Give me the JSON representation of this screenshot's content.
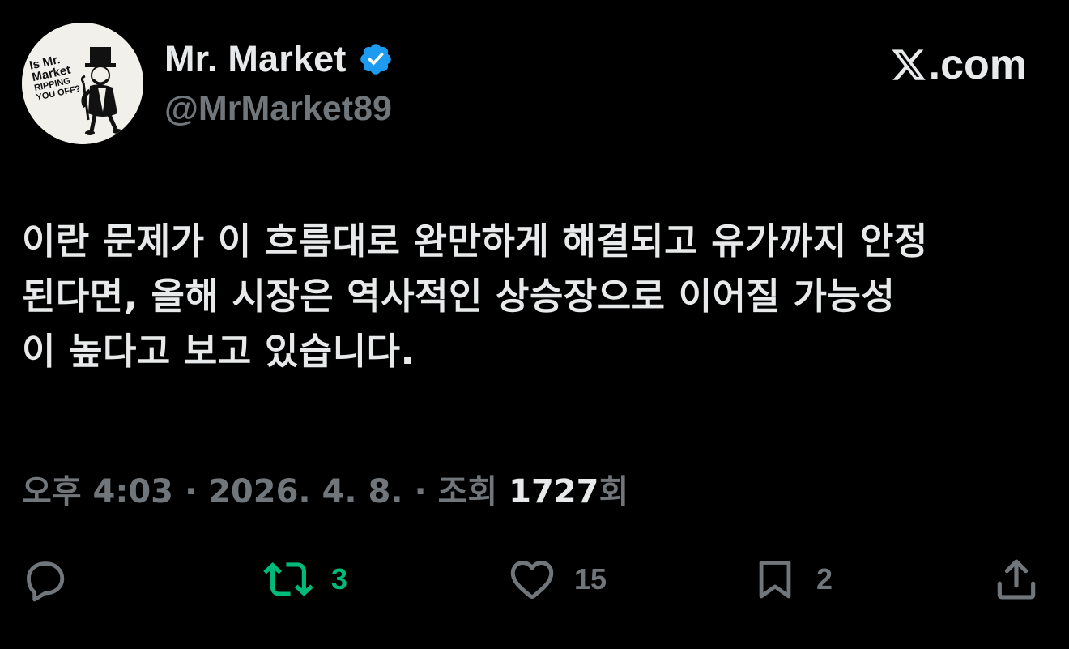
{
  "header": {
    "avatar": {
      "icon": "mr-market-monopoly-avatar",
      "caption_line1": "Is Mr.",
      "caption_line2": "Market",
      "caption_line3": "RIPPING",
      "caption_line4": "YOU OFF?"
    },
    "display_name": "Mr. Market",
    "verified_icon": "verified-badge-icon",
    "handle": "@MrMarket89",
    "brand": {
      "icon": "x-logo-icon",
      "text": ".com"
    }
  },
  "tweet": {
    "lines": [
      "이란 문제가 이 흐름대로 완만하게 해결되고 유가까지 안정",
      "된다면, 올해 시장은 역사적인 상승장으로 이어질 가능성",
      "이 높다고 보고 있습니다."
    ]
  },
  "meta": {
    "time": "오후 4:03",
    "separator": " · ",
    "date": "2026. 4. 8.",
    "views_label": "조회",
    "views_count": "1727",
    "views_suffix": "회"
  },
  "actions": {
    "reply": {
      "icon": "reply-icon",
      "count": ""
    },
    "retweet": {
      "icon": "retweet-icon",
      "count": "3"
    },
    "like": {
      "icon": "heart-icon",
      "count": "15"
    },
    "bookmark": {
      "icon": "bookmark-icon",
      "count": "2"
    },
    "share": {
      "icon": "share-icon",
      "count": ""
    }
  },
  "colors": {
    "background": "#000000",
    "primary_text": "#e7e9ea",
    "secondary_text": "#71767b",
    "verified_blue": "#1d9bf0",
    "retweet_green": "#00ba7c"
  }
}
